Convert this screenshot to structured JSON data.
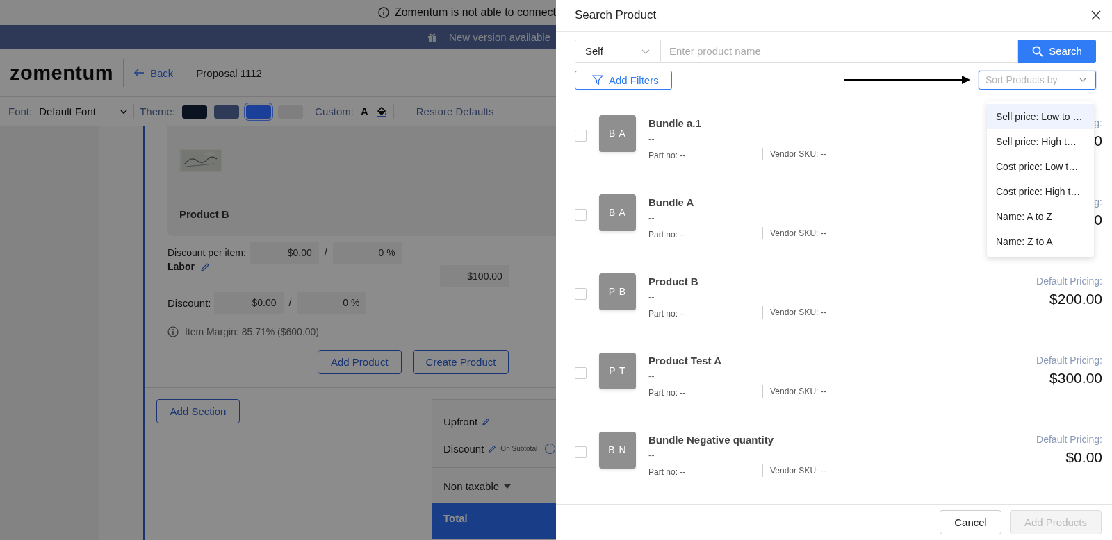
{
  "notice": {
    "text": "Zomentum is not able to connect"
  },
  "update_bar": {
    "text": "New version available"
  },
  "header": {
    "logo": "zomentum",
    "back": "Back",
    "title": "Proposal 1112"
  },
  "toolbar": {
    "font_label": "Font:",
    "font_value": "Default Font",
    "theme_label": "Theme:",
    "themes": [
      {
        "color": "#0b1220",
        "selected": false
      },
      {
        "color": "#2e3a57",
        "selected": false
      },
      {
        "color": "#1c3f9a",
        "selected": true
      },
      {
        "color": "#7f7f7f",
        "selected": false
      }
    ],
    "custom_label": "Custom:",
    "text_color_glyph": "A",
    "restore": "Restore Defaults"
  },
  "editor": {
    "product_title": "Product B",
    "discount_per_item": {
      "label": "Discount per item:",
      "amount": "$0.00",
      "separator": "/",
      "percent": "0 %"
    },
    "labor": {
      "name": "Labor",
      "price": "$100.00"
    },
    "discount": {
      "label": "Discount:",
      "amount": "$0.00",
      "separator": "/",
      "percent": "0 %"
    },
    "margin": "Item Margin: 85.71% ($600.00)",
    "buttons": [
      "Add Product",
      "Create Product"
    ],
    "add_section": "Add Section"
  },
  "summary": {
    "upfront": "Upfront",
    "discount": "Discount",
    "discount_note": "On Subtotal",
    "info_glyph": "!",
    "tax": "Non taxable",
    "total": "Total"
  },
  "modal": {
    "title": "Search Product",
    "scope": "Self",
    "search_placeholder": "Enter product name",
    "search_button": "Search",
    "filters_button": "Add Filters",
    "sort_placeholder": "Sort Products by",
    "sort_options": [
      {
        "label": "Sell price: Low to …",
        "selected": true
      },
      {
        "label": "Sell price: High t…",
        "selected": false
      },
      {
        "label": "Cost price: Low t…",
        "selected": false
      },
      {
        "label": "Cost price: High t…",
        "selected": false
      },
      {
        "label": "Name: A to Z",
        "selected": false
      },
      {
        "label": "Name: Z to A",
        "selected": false
      }
    ],
    "products": [
      {
        "initials": "B A",
        "name": "Bundle a.1",
        "description": "--",
        "part_no": "Part no: --",
        "vendor_sku": "Vendor SKU: --",
        "checked": false,
        "pricing_label": "g:",
        "price": "0"
      },
      {
        "initials": "B A",
        "name": "Bundle A",
        "description": "--",
        "part_no": "Part no: --",
        "vendor_sku": "Vendor SKU: --",
        "checked": false,
        "pricing_label": "g:",
        "price": "0"
      },
      {
        "initials": "P B",
        "name": "Product B",
        "description": "--",
        "part_no": "Part no: --",
        "vendor_sku": "Vendor SKU: --",
        "checked": false,
        "pricing_label": "Default Pricing:",
        "price": "$200.00"
      },
      {
        "initials": "P T",
        "name": "Product Test A",
        "description": "--",
        "part_no": "Part no: --",
        "vendor_sku": "Vendor SKU: --",
        "checked": false,
        "pricing_label": "Default Pricing:",
        "price": "$300.00"
      },
      {
        "initials": "B N",
        "name": "Bundle Negative quantity",
        "description": "--",
        "part_no": "Part no: --",
        "vendor_sku": "Vendor SKU: --",
        "checked": false,
        "pricing_label": "Default Pricing:",
        "price": "$0.00"
      }
    ],
    "cancel": "Cancel",
    "add_button": {
      "label": "Add Products",
      "disabled": true
    }
  }
}
